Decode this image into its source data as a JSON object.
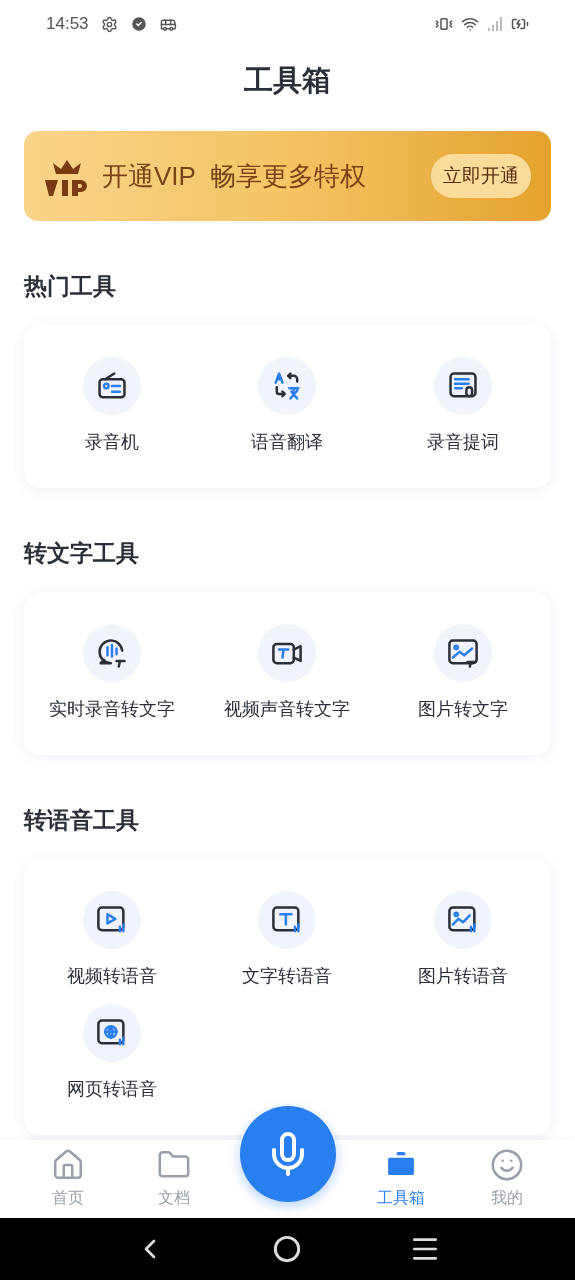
{
  "status_bar": {
    "time": "14:53"
  },
  "title": "工具箱",
  "vip_banner": {
    "text": "开通VIP  畅享更多特权",
    "button": "立即开通"
  },
  "sections": [
    {
      "title": "热门工具",
      "tools": [
        {
          "label": "录音机",
          "kind": "recorder"
        },
        {
          "label": "语音翻译",
          "kind": "translate"
        },
        {
          "label": "录音提词",
          "kind": "prompter"
        }
      ]
    },
    {
      "title": "转文字工具",
      "tools": [
        {
          "label": "实时录音转文字",
          "kind": "live"
        },
        {
          "label": "视频声音转文字",
          "kind": "video-text"
        },
        {
          "label": "图片转文字",
          "kind": "image-text"
        }
      ]
    },
    {
      "title": "转语音工具",
      "tools": [
        {
          "label": "视频转语音",
          "kind": "video-voice"
        },
        {
          "label": "文字转语音",
          "kind": "text-voice"
        },
        {
          "label": "图片转语音",
          "kind": "image-voice"
        },
        {
          "label": "网页转语音",
          "kind": "web-voice"
        }
      ]
    }
  ],
  "tab_bar": [
    {
      "label": "首页",
      "kind": "home",
      "selected": false
    },
    {
      "label": "文档",
      "kind": "docs",
      "selected": false
    },
    {
      "label": "工具箱",
      "kind": "tools",
      "selected": true
    },
    {
      "label": "我的",
      "kind": "me",
      "selected": false
    }
  ]
}
